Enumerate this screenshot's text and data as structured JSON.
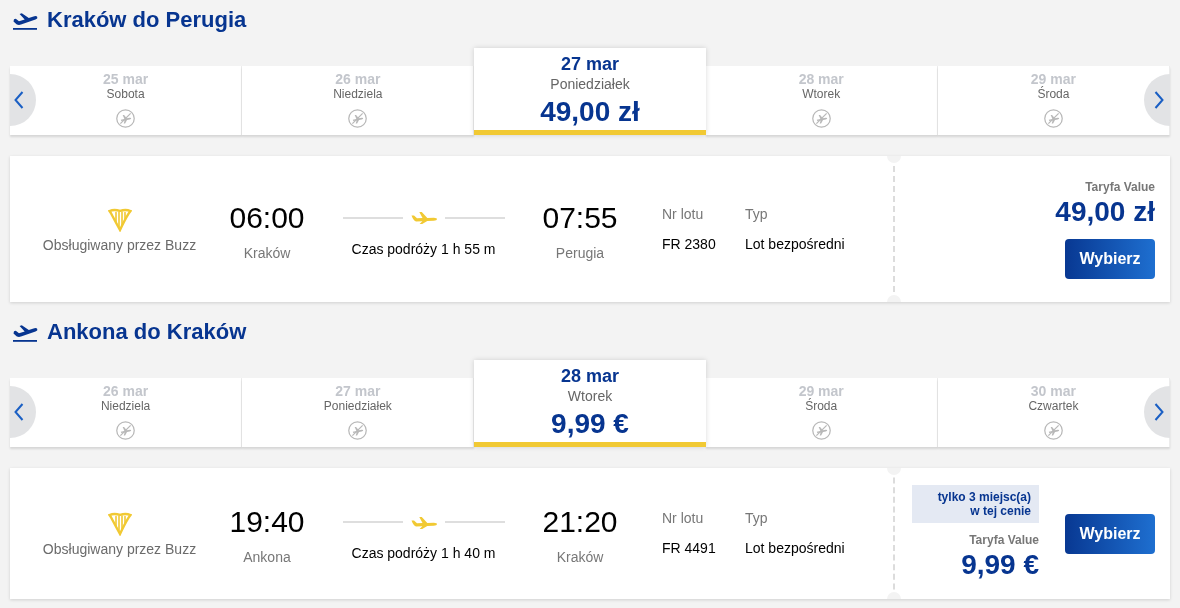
{
  "sections": [
    {
      "title": "Kraków do Perugia",
      "dates": [
        {
          "date": "25 mar",
          "day": "Sobota",
          "selected": false,
          "kind": "unavailable"
        },
        {
          "date": "26 mar",
          "day": "Niedziela",
          "selected": false,
          "kind": "unavailable"
        },
        {
          "date": "27 mar",
          "day": "Poniedziałek",
          "selected": true,
          "kind": "fare",
          "price": "49,00 zł"
        },
        {
          "date": "28 mar",
          "day": "Wtorek",
          "selected": false,
          "kind": "unavailable"
        },
        {
          "date": "29 mar",
          "day": "Środa",
          "selected": false,
          "kind": "unavailable"
        }
      ],
      "flight": {
        "operator": "Obsługiwany przez Buzz",
        "departure": {
          "time": "06:00",
          "city": "Kraków"
        },
        "duration": "Czas podróży 1 h 55 m",
        "arrival": {
          "time": "07:55",
          "city": "Perugia"
        },
        "details": [
          {
            "label": "Nr lotu",
            "value": "FR 2380"
          },
          {
            "label": "Typ",
            "value": "Lot bezpośredni"
          }
        ],
        "fare": {
          "label": "Taryfa Value",
          "price": "49,00 zł"
        },
        "button": "Wybierz"
      }
    },
    {
      "title": "Ankona do Kraków",
      "dates": [
        {
          "date": "26 mar",
          "day": "Niedziela",
          "selected": false,
          "kind": "unavailable"
        },
        {
          "date": "27 mar",
          "day": "Poniedziałek",
          "selected": false,
          "kind": "unavailable"
        },
        {
          "date": "28 mar",
          "day": "Wtorek",
          "selected": true,
          "kind": "fare",
          "price": "9,99 €"
        },
        {
          "date": "29 mar",
          "day": "Środa",
          "selected": false,
          "kind": "unavailable"
        },
        {
          "date": "30 mar",
          "day": "Czwartek",
          "selected": false,
          "kind": "unavailable"
        }
      ],
      "flight": {
        "operator": "Obsługiwany przez Buzz",
        "departure": {
          "time": "19:40",
          "city": "Ankona"
        },
        "duration": "Czas podróży 1 h 40 m",
        "arrival": {
          "time": "21:20",
          "city": "Kraków"
        },
        "details": [
          {
            "label": "Nr lotu",
            "value": "FR 4491"
          },
          {
            "label": "Typ",
            "value": "Lot bezpośredni"
          }
        ],
        "fare": {
          "notice": "tylko 3 miejsc(a) w tej cenie",
          "label": "Taryfa Value",
          "price": "9,99 €"
        },
        "button": "Wybierz"
      }
    }
  ]
}
